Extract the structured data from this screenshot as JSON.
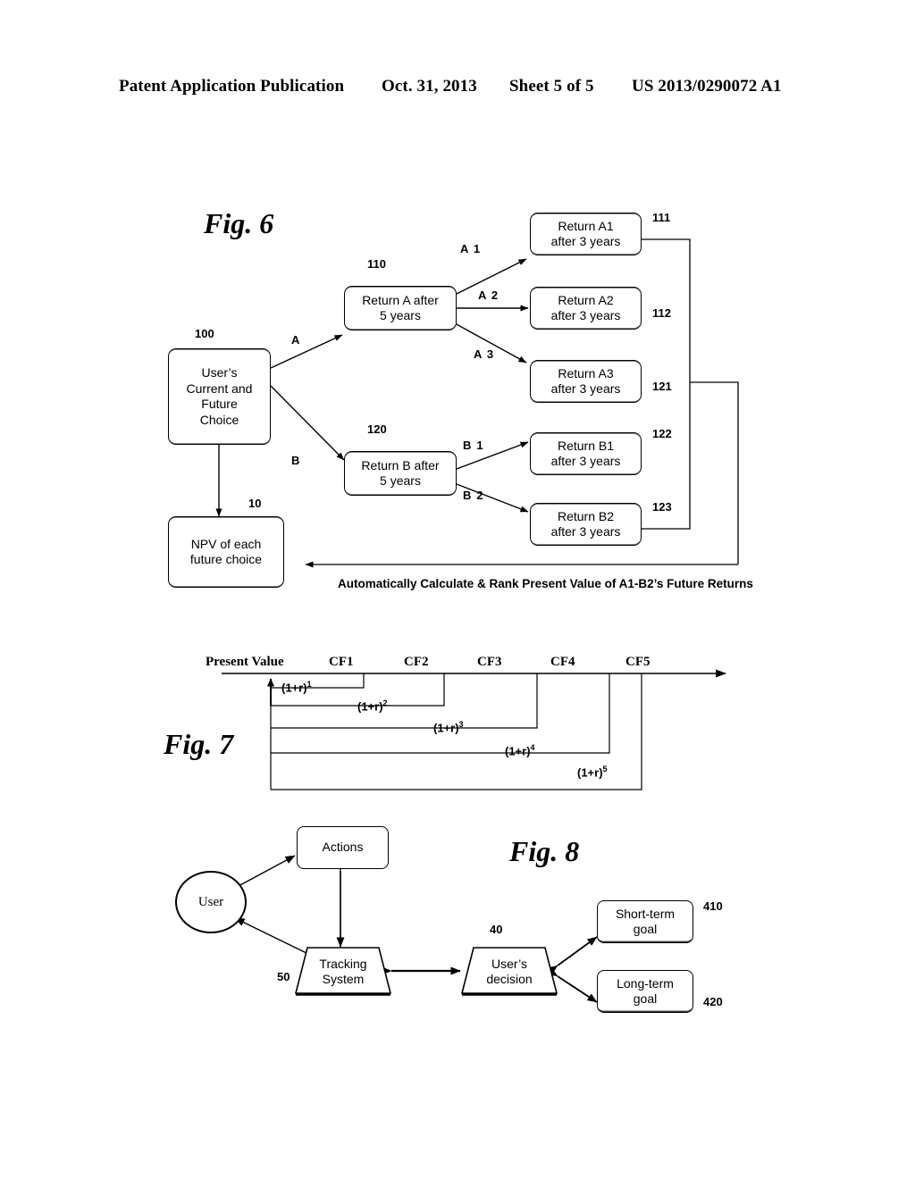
{
  "header": {
    "publication": "Patent Application Publication",
    "date": "Oct. 31, 2013",
    "sheet": "Sheet 5 of 5",
    "patent_number": "US 2013/0290072 A1"
  },
  "fig6": {
    "label": "Fig. 6",
    "nodes": {
      "choice": {
        "line1": "User’s",
        "line2": "Current and",
        "line3": "Future",
        "line4": "Choice",
        "ref": "100"
      },
      "npv": {
        "line1": "NPV of each",
        "line2": "future choice",
        "ref": "10"
      },
      "returnA": {
        "line1": "Return A after",
        "line2": "5 years",
        "ref": "110"
      },
      "returnB": {
        "line1": "Return B after",
        "line2": "5 years",
        "ref": "120"
      },
      "a1": {
        "line1": "Return A1",
        "line2": "after 3 years",
        "ref": "111"
      },
      "a2": {
        "line1": "Return A2",
        "line2": "after 3 years",
        "ref": "112"
      },
      "a3": {
        "line1": "Return A3",
        "line2": "after 3 years",
        "ref": "121"
      },
      "b1": {
        "line1": "Return B1",
        "line2": "after 3 years",
        "ref": "122"
      },
      "b2": {
        "line1": "Return B2",
        "line2": "after 3 years",
        "ref": "123"
      }
    },
    "edges": {
      "a": "A",
      "b": "B",
      "a1": "A 1",
      "a2": "A 2",
      "a3": "A 3",
      "b1": "B 1",
      "b2": "B 2"
    },
    "caption": "Automatically Calculate & Rank Present Value of A1-B2’s Future Returns"
  },
  "fig7": {
    "label": "Fig. 7",
    "axis_label": "Present Value",
    "cash_flows": [
      "CF1",
      "CF2",
      "CF3",
      "CF4",
      "CF5"
    ],
    "discount_factors": [
      {
        "base": "(1+r)",
        "exp": "1"
      },
      {
        "base": "(1+r)",
        "exp": "2"
      },
      {
        "base": "(1+r)",
        "exp": "3"
      },
      {
        "base": "(1+r)",
        "exp": "4"
      },
      {
        "base": "(1+r)",
        "exp": "5"
      }
    ]
  },
  "fig8": {
    "label": "Fig. 8",
    "nodes": {
      "user": {
        "text": "User"
      },
      "actions": {
        "text": "Actions"
      },
      "tracking": {
        "line1": "Tracking",
        "line2": "System",
        "ref": "50"
      },
      "decision": {
        "line1": "User’s",
        "line2": "decision",
        "ref": "40"
      },
      "short": {
        "line1": "Short-term",
        "line2": "goal",
        "ref": "410"
      },
      "long": {
        "line1": "Long-term",
        "line2": "goal",
        "ref": "420"
      }
    }
  }
}
